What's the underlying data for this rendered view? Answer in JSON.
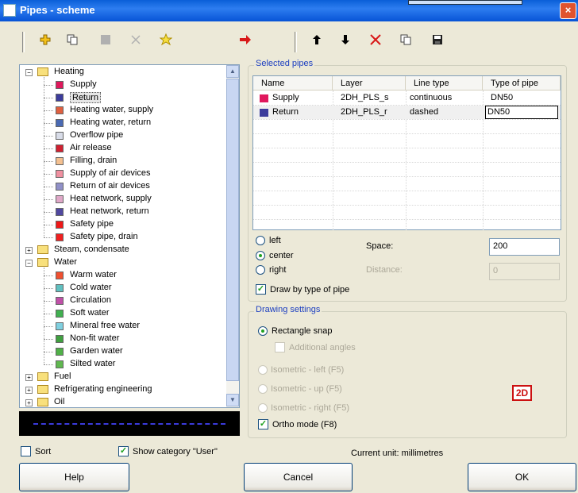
{
  "window": {
    "title": "Pipes - scheme",
    "close_glyph": "×",
    "app_icon": "app-icon"
  },
  "toolbar_left": {
    "icons": [
      "add-icon",
      "copy-icon",
      "stop-icon",
      "delete-icon",
      "favorite-icon"
    ],
    "transfer_icon": "arrow-right-icon"
  },
  "toolbar_right": {
    "icons": [
      "move-up-icon",
      "move-down-icon",
      "delete-icon",
      "copy-icon",
      "save-icon"
    ]
  },
  "tree": {
    "groups": [
      {
        "label": "Heating",
        "expanded": true,
        "items": [
          {
            "label": "Supply",
            "color": "#e0185c"
          },
          {
            "label": "Return",
            "color": "#3c3c9c"
          },
          {
            "label": "Heating water, supply",
            "color": "#e06040"
          },
          {
            "label": "Heating water, return",
            "color": "#4a6ab4"
          },
          {
            "label": "Overflow pipe",
            "color": "#d8dce8"
          },
          {
            "label": "Air release",
            "color": "#d02030"
          },
          {
            "label": "Filling, drain",
            "color": "#f4c090"
          },
          {
            "label": "Supply of air devices",
            "color": "#f090a0"
          },
          {
            "label": "Return of air devices",
            "color": "#9090c8"
          },
          {
            "label": "Heat network, supply",
            "color": "#e0a8c8"
          },
          {
            "label": "Heat network, return",
            "color": "#5048a0"
          },
          {
            "label": "Safety pipe",
            "color": "#f01818"
          },
          {
            "label": "Safety pipe, drain",
            "color": "#f02020"
          }
        ]
      },
      {
        "label": "Steam, condensate",
        "expanded": false,
        "items": []
      },
      {
        "label": "Water",
        "expanded": true,
        "items": [
          {
            "label": "Warm water",
            "color": "#f05030"
          },
          {
            "label": "Cold water",
            "color": "#60c0c0"
          },
          {
            "label": "Circulation",
            "color": "#c050a8"
          },
          {
            "label": "Soft water",
            "color": "#40b050"
          },
          {
            "label": "Mineral free water",
            "color": "#80d0e0"
          },
          {
            "label": "Non-fit water",
            "color": "#40a040"
          },
          {
            "label": "Garden water",
            "color": "#50b048"
          },
          {
            "label": "Silted water",
            "color": "#60b850"
          }
        ]
      },
      {
        "label": "Fuel",
        "expanded": false,
        "items": []
      },
      {
        "label": "Refrigerating engineering",
        "expanded": false,
        "items": []
      },
      {
        "label": "Oil",
        "expanded": false,
        "items": []
      }
    ],
    "selected": "Return"
  },
  "selected_pipes": {
    "group_label": "Selected pipes",
    "columns": [
      "Name",
      "Layer",
      "Line type",
      "Type of pipe"
    ],
    "rows": [
      {
        "name": "Supply",
        "color": "#e0185c",
        "layer": "2DH_PLS_s",
        "line_type": "continuous",
        "type": "DN50"
      },
      {
        "name": "Return",
        "color": "#3c3c9c",
        "layer": "2DH_PLS_r",
        "line_type": "dashed",
        "type": "DN50"
      }
    ]
  },
  "placement": {
    "left": "left",
    "center": "center",
    "right": "right",
    "selected": "center",
    "space_label": "Space:",
    "space_value": "200",
    "distance_label": "Distance:",
    "distance_value": "0",
    "draw_by_type_label": "Draw by type of pipe",
    "draw_by_type_checked": true
  },
  "drawing_settings": {
    "group_label": "Drawing settings",
    "rectangle_snap": "Rectangle snap",
    "additional_angles": "Additional angles",
    "iso_left": "Isometric - left (F5)",
    "iso_up": "Isometric - up (F5)",
    "iso_right": "Isometric - right (F5)",
    "ortho_mode": "Ortho mode (F8)",
    "ortho_checked": true,
    "mode_2d": "2D"
  },
  "footer": {
    "sort_label": "Sort",
    "sort_checked": false,
    "show_user_label": "Show category \"User\"",
    "show_user_checked": true,
    "unit_text": "Current unit: millimetres",
    "help": "Help",
    "cancel": "Cancel",
    "ok": "OK"
  }
}
